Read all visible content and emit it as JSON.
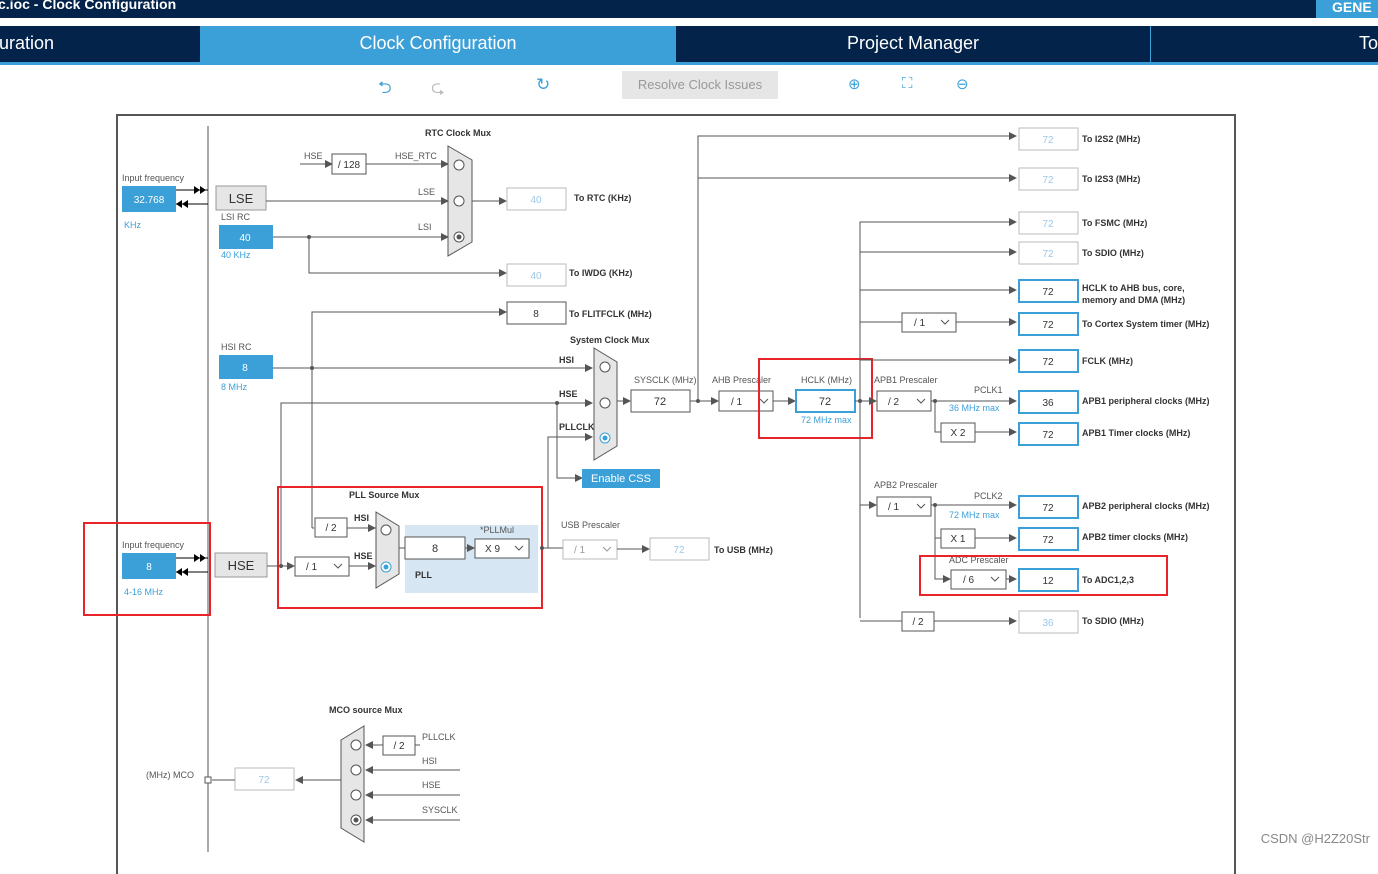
{
  "app": {
    "title": "c.ioc - Clock Configuration",
    "generate_label": "GENE"
  },
  "tabs": [
    {
      "label": "uration"
    },
    {
      "label": "Clock Configuration"
    },
    {
      "label": "Project Manager"
    },
    {
      "label": "To"
    }
  ],
  "toolbar": {
    "resolve_label": "Resolve Clock Issues"
  },
  "lse": {
    "input_label": "Input frequency",
    "value": "32.768",
    "unit": "KHz",
    "name": "LSE"
  },
  "lsi": {
    "label": "LSI RC",
    "value": "40",
    "unit": "40 KHz"
  },
  "hsi": {
    "label": "HSI RC",
    "value": "8",
    "unit": "8 MHz"
  },
  "hse": {
    "input_label": "Input frequency",
    "value": "8",
    "range": "4-16 MHz",
    "name": "HSE"
  },
  "rtc": {
    "mux_title": "RTC Clock Mux",
    "hse_in": "HSE",
    "div128": "/ 128",
    "hse_rtc": "HSE_RTC",
    "lse_in": "LSE",
    "lsi_in": "LSI",
    "out_value": "40",
    "out_label": "To RTC (KHz)"
  },
  "iwdg": {
    "value": "40",
    "label": "To IWDG (KHz)"
  },
  "flitf": {
    "value": "8",
    "label": "To FLITFCLK (MHz)"
  },
  "sysmux": {
    "title": "System Clock Mux",
    "hsi": "HSI",
    "hse": "HSE",
    "pllclk": "PLLCLK",
    "enable_css": "Enable CSS"
  },
  "sysclk": {
    "label": "SYSCLK (MHz)",
    "value": "72"
  },
  "ahb": {
    "label": "AHB Prescaler",
    "value": "/ 1"
  },
  "hclk": {
    "label": "HCLK (MHz)",
    "value": "72",
    "max": "72 MHz max"
  },
  "apb1": {
    "label": "APB1 Prescaler",
    "value": "/ 2",
    "pclk": "PCLK1",
    "max": "36 MHz max",
    "timer_mult": "X 2"
  },
  "apb2": {
    "label": "APB2 Prescaler",
    "value": "/ 1",
    "pclk": "PCLK2",
    "max": "72 MHz max",
    "timer_mult": "X 1"
  },
  "adc": {
    "label": "ADC Prescaler",
    "value": "/ 6"
  },
  "cortex_div": "/ 1",
  "sdio_div": "/ 2",
  "pll": {
    "title": "PLL Source Mux",
    "hsi_div": "/ 2",
    "hsi": "HSI",
    "hse": "HSE",
    "hse_div": "/ 1",
    "value": "8",
    "mul_label": "*PLLMul",
    "mul": "X 9",
    "name": "PLL"
  },
  "usb": {
    "label": "USB Prescaler",
    "value": "/ 1",
    "out": "72",
    "out_label": "To USB (MHz)"
  },
  "outputs": [
    {
      "value": "72",
      "label": "To I2S2 (MHz)"
    },
    {
      "value": "72",
      "label": "To I2S3 (MHz)"
    },
    {
      "value": "72",
      "label": "To FSMC (MHz)"
    },
    {
      "value": "72",
      "label": "To SDIO (MHz)"
    },
    {
      "value": "72",
      "label": "HCLK to AHB bus, core,",
      "label2": "memory and DMA (MHz)"
    },
    {
      "value": "72",
      "label": "To Cortex System timer (MHz)"
    },
    {
      "value": "72",
      "label": "FCLK (MHz)"
    },
    {
      "value": "36",
      "label": "APB1 peripheral clocks (MHz)"
    },
    {
      "value": "72",
      "label": "APB1 Timer clocks (MHz)"
    },
    {
      "value": "72",
      "label": "APB2 peripheral clocks (MHz)"
    },
    {
      "value": "72",
      "label": "APB2 timer clocks (MHz)"
    },
    {
      "value": "12",
      "label": "To ADC1,2,3"
    },
    {
      "value": "36",
      "label": "To SDIO (MHz)"
    }
  ],
  "mco": {
    "title": "MCO source Mux",
    "pll_div": "/ 2",
    "pllclk": "PLLCLK",
    "hsi": "HSI",
    "hse": "HSE",
    "sysclk": "SYSCLK",
    "label": "(MHz) MCO",
    "value": "72"
  },
  "watermark": "CSDN @H2Z20Str",
  "colors": {
    "navy": "#03234b",
    "accent": "#3ca0d8",
    "highlight": "#e8232a"
  }
}
